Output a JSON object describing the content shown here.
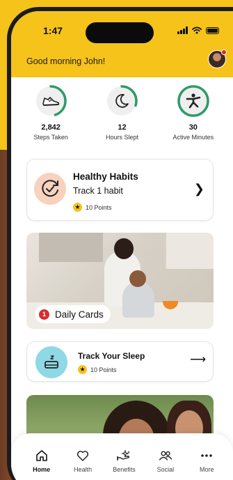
{
  "status_bar": {
    "time": "1:47"
  },
  "header": {
    "greeting": "Good morning John!",
    "avatar_notification": true
  },
  "stats": [
    {
      "value": "2,842",
      "label": "Steps Taken",
      "icon": "sneaker-icon",
      "progress": 0.45
    },
    {
      "value": "12",
      "label": "Hours Slept",
      "icon": "moon-icon",
      "progress": 0.3
    },
    {
      "value": "30",
      "label": "Active Minutes",
      "icon": "running-person-icon",
      "progress": 1.0
    }
  ],
  "habits_card": {
    "title": "Healthy Habits",
    "subtitle": "Track 1 habit",
    "points": "10 Points"
  },
  "daily_cards": {
    "count": "1",
    "label": "Daily Cards"
  },
  "sleep_card": {
    "title": "Track Your Sleep",
    "points": "10 Points"
  },
  "tabs": [
    {
      "label": "Home",
      "icon": "home-icon",
      "active": true
    },
    {
      "label": "Health",
      "icon": "heart-icon",
      "active": false
    },
    {
      "label": "Benefits",
      "icon": "benefits-hands-icon",
      "active": false
    },
    {
      "label": "Social",
      "icon": "people-icon",
      "active": false
    },
    {
      "label": "More",
      "icon": "more-dots-icon",
      "active": false
    }
  ],
  "colors": {
    "brand_yellow": "#f5c31a",
    "ring_green": "#2e9a6a",
    "habit_peach": "#f7d2bf",
    "sleep_cyan": "#8fd8e6",
    "badge_red": "#d62e2e"
  }
}
